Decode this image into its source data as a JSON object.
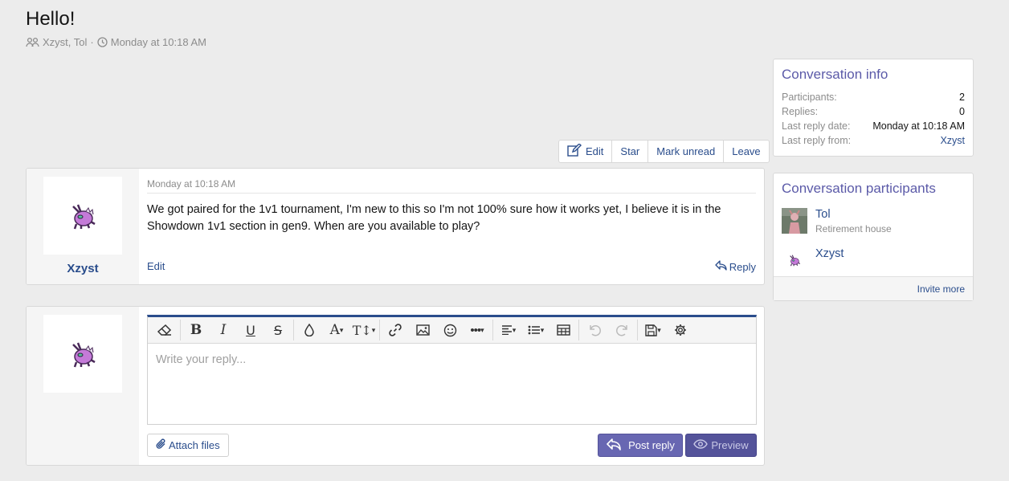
{
  "header": {
    "title": "Hello!",
    "participants_text": "Xzyst, Tol",
    "separator": "·",
    "date": "Monday at 10:18 AM"
  },
  "actions": {
    "edit": "Edit",
    "star": "Star",
    "mark_unread": "Mark unread",
    "leave": "Leave"
  },
  "message": {
    "date": "Monday at 10:18 AM",
    "username": "Xzyst",
    "body": "We got paired for the 1v1 tournament, I'm new to this so I'm not 100% sure how it works yet, I believe it is in the Showdown 1v1 section in gen9. When are you available to play?",
    "edit_label": "Edit",
    "reply_label": "Reply"
  },
  "reply_form": {
    "placeholder": "Write your reply...",
    "attach_label": "Attach files",
    "post_label": "Post reply",
    "preview_label": "Preview"
  },
  "sidebar": {
    "info": {
      "title": "Conversation info",
      "rows": [
        {
          "key": "Participants:",
          "value": "2"
        },
        {
          "key": "Replies:",
          "value": "0"
        },
        {
          "key": "Last reply date:",
          "value": "Monday at 10:18 AM"
        },
        {
          "key": "Last reply from:",
          "value": "Xzyst"
        }
      ]
    },
    "participants": {
      "title": "Conversation participants",
      "list": [
        {
          "name": "Tol",
          "subtitle": "Retirement house"
        },
        {
          "name": "Xzyst",
          "subtitle": ""
        }
      ],
      "invite_label": "Invite more"
    }
  },
  "colors": {
    "link": "#2a4d8c",
    "accent": "#6867b2",
    "title_accent": "#5b5aa8"
  }
}
